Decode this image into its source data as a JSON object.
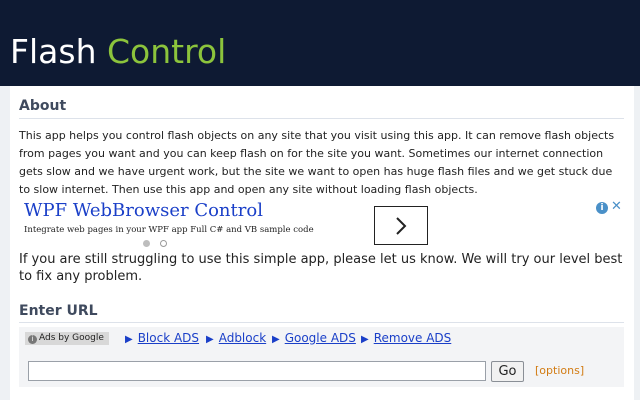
{
  "header": {
    "title_part1": "Flash",
    "title_part2": "Control"
  },
  "about": {
    "heading": "About",
    "text": "This app helps you control flash objects on any site that you visit using this app. It can remove flash objects from pages you want and you can keep flash on for the site you want. Sometimes our internet connection gets slow and we have urgent work, but the site we want to open has huge flash files and we get stuck due to slow internet. Then use this app and open any site without loading flash objects."
  },
  "ad": {
    "title": "WPF WebBrowser Control",
    "subtitle": "Integrate web pages in your WPF app Full C# and VB sample code",
    "arrow_icon": "chevron-right-icon",
    "info_glyph": "i",
    "close_glyph": "✕"
  },
  "support_text": "If you are still struggling to use this simple app, please let us know. We will try our level best to fix any problem.",
  "enter_url": {
    "heading": "Enter URL",
    "ads_by": "Ads by Google",
    "links": [
      "Block ADS",
      "Adblock",
      "Google ADS",
      "Remove ADS"
    ],
    "url_value": "",
    "go_label": "Go",
    "options_label": "options"
  },
  "colors": {
    "header_bg": "#0e1a33",
    "title_accent": "#8cc43c",
    "link": "#1a3fc8",
    "options": "#d27c14"
  }
}
